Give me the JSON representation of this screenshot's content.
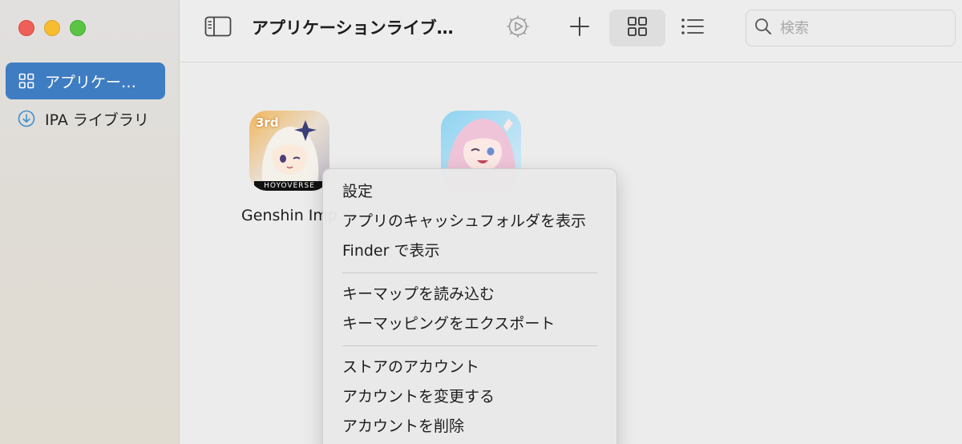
{
  "window": {
    "traffic_lights": {
      "close": "#ee5f58",
      "minimize": "#f6be2f",
      "maximize": "#5cc444"
    }
  },
  "sidebar": {
    "accent": "#3f7dc3",
    "items": [
      {
        "label": "アプリケー…",
        "icon": "grid-icon",
        "active": true
      },
      {
        "label": "IPA ライブラリ",
        "icon": "download-circle-icon",
        "active": false
      }
    ]
  },
  "toolbar": {
    "title": "アプリケーションライブ…",
    "buttons": [
      "sidebar-toggle-icon",
      "gear-play-icon",
      "plus-icon",
      "grid-view-icon",
      "list-view-icon"
    ],
    "active_view": "grid",
    "search": {
      "placeholder": "検索",
      "value": ""
    }
  },
  "apps": [
    {
      "name": "Genshin Imp",
      "badge": "3rd",
      "brand": "HOYOVERSE"
    },
    {
      "name": ""
    }
  ],
  "context_menu": {
    "groups": [
      [
        "設定",
        "アプリのキャッシュフォルダを表示",
        "Finder で表示"
      ],
      [
        "キーマップを読み込む",
        "キーマッピングをエクスポート"
      ],
      [
        "ストアのアカウント",
        "アカウントを変更する",
        "アカウントを削除"
      ]
    ]
  }
}
